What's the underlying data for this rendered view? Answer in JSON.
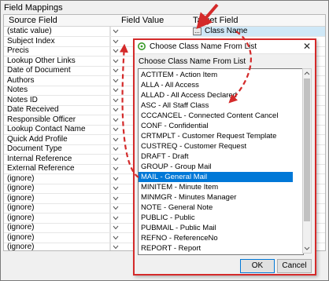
{
  "panel": {
    "title": "Field Mappings"
  },
  "grid": {
    "columns": {
      "source": "Source Field",
      "value": "Field Value",
      "target": "Target Field"
    },
    "rows": [
      {
        "source": "(static value)",
        "target": "Class Name"
      },
      {
        "source": "Subject Index"
      },
      {
        "source": "Precis"
      },
      {
        "source": "Lookup Other Links"
      },
      {
        "source": "Date of Document"
      },
      {
        "source": "Authors"
      },
      {
        "source": "Notes"
      },
      {
        "source": "Notes ID"
      },
      {
        "source": "Date Received"
      },
      {
        "source": "Responsible Officer"
      },
      {
        "source": "Lookup Contact Name"
      },
      {
        "source": "Quick Add Profile"
      },
      {
        "source": "Document Type"
      },
      {
        "source": "Internal Reference"
      },
      {
        "source": "External Reference"
      },
      {
        "source": "(ignore)"
      },
      {
        "source": "(ignore)"
      },
      {
        "source": "(ignore)"
      },
      {
        "source": "(ignore)"
      },
      {
        "source": "(ignore)"
      },
      {
        "source": "(ignore)"
      },
      {
        "source": "(ignore)"
      },
      {
        "source": "(ignore)"
      }
    ],
    "ellipsis_label": "..."
  },
  "dialog": {
    "title": "Choose Class Name From List",
    "caption": "Choose Class Name From List",
    "items": [
      "ACTITEM - Action Item",
      "ALLA - All Access",
      "ALLAD - All Access Declared",
      "ASC - All Staff Class",
      "CCCANCEL - Connected Content Cancel",
      "CONF - Confidential",
      "CRTMPLT - Customer Request Template",
      "CUSTREQ - Customer Request",
      "DRAFT - Draft",
      "GROUP - Group Mail",
      "MAIL - General Mail",
      "MINITEM - Minute Item",
      "MINMGR - Minutes Manager",
      "NOTE - General Note",
      "PUBLIC - Public",
      "PUBMAIL - Public Mail",
      "REFNO - ReferenceNo",
      "REPORT - Report"
    ],
    "selected_index": 10,
    "ok_label": "OK",
    "cancel_label": "Cancel",
    "close_glyph": "✕"
  },
  "colors": {
    "annotation": "#d42a2a",
    "selection": "#0078d7",
    "target_highlight": "#cfe8f7"
  }
}
